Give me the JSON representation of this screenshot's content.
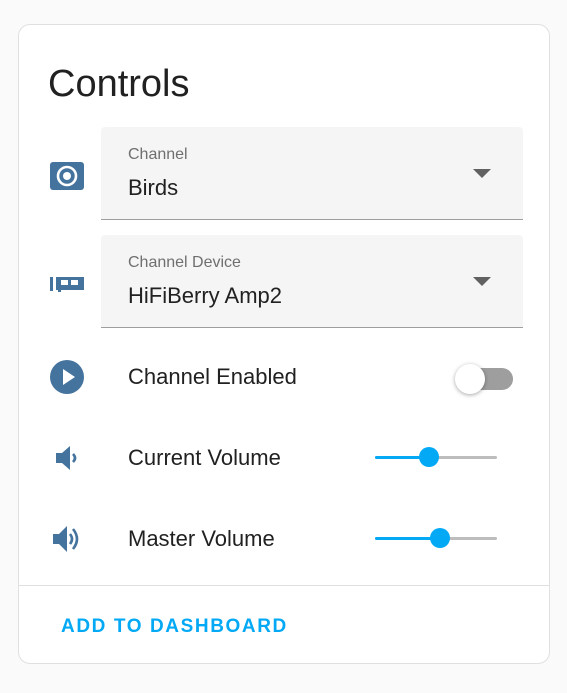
{
  "card": {
    "title": "Controls"
  },
  "channel": {
    "label": "Channel",
    "value": "Birds",
    "icon": "speaker-wireless-icon"
  },
  "channel_device": {
    "label": "Channel Device",
    "value": "HiFiBerry Amp2",
    "icon": "expansion-card-icon"
  },
  "channel_enabled": {
    "label": "Channel Enabled",
    "state": "off",
    "icon": "play-circle-icon"
  },
  "current_volume": {
    "label": "Current Volume",
    "value_fraction": 0.44,
    "icon": "volume-low-icon"
  },
  "master_volume": {
    "label": "Master Volume",
    "value_fraction": 0.53,
    "icon": "volume-high-icon"
  },
  "actions": {
    "add_to_dashboard": "ADD TO DASHBOARD"
  },
  "colors": {
    "accent": "#03a9f4",
    "icon": "#44739e",
    "text": "#212121",
    "secondary_text": "#6f6f6f",
    "toggle_off_track": "#9e9e9e"
  }
}
